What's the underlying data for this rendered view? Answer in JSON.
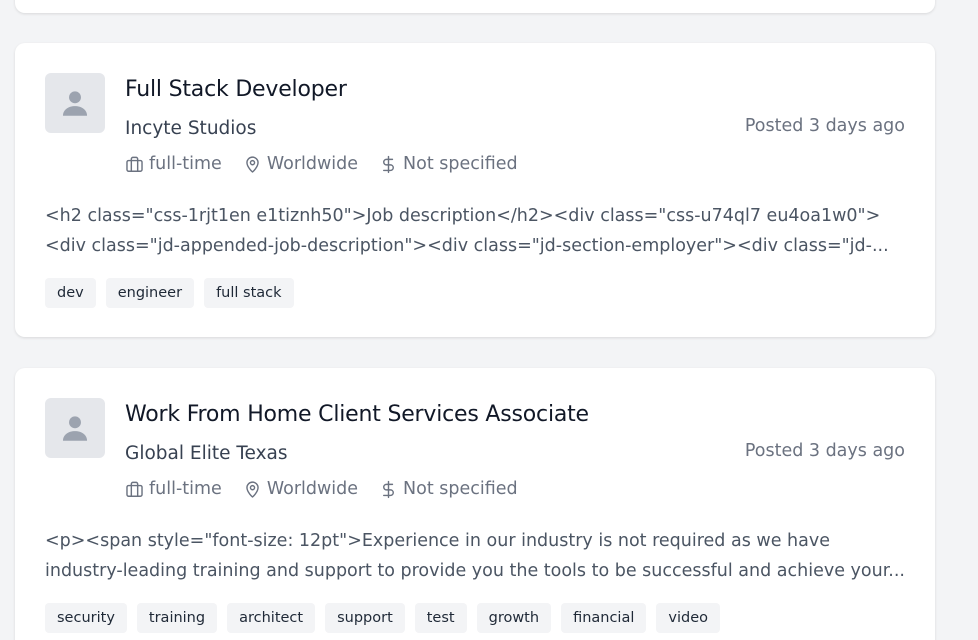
{
  "jobs": [
    {
      "title": "Full Stack Developer",
      "company": "Incyte Studios",
      "posted": "Posted 3 days ago",
      "type": "full-time",
      "location": "Worldwide",
      "salary": "Not specified",
      "description": "<h2 class=\"css-1rjt1en e1tiznh50\">Job description</h2><div class=\"css-u74ql7 eu4oa1w0\"><div class=\"jd-appended-job-description\"><div class=\"jd-section-employer\"><div class=\"jd-...",
      "tags": [
        "dev",
        "engineer",
        "full stack"
      ]
    },
    {
      "title": "Work From Home Client Services Associate",
      "company": "Global Elite Texas",
      "posted": "Posted 3 days ago",
      "type": "full-time",
      "location": "Worldwide",
      "salary": "Not specified",
      "description": "<p><span style=\"font-size: 12pt\">Experience in our industry is not required as we have industry-leading training and support to provide you the tools to be successful and achieve your...",
      "tags": [
        "security",
        "training",
        "architect",
        "support",
        "test",
        "growth",
        "financial",
        "video"
      ]
    }
  ],
  "icons": {
    "avatar": "person-placeholder-icon",
    "type": "briefcase-icon",
    "location": "map-pin-icon",
    "salary": "dollar-icon"
  },
  "colors": {
    "background": "#f3f4f6",
    "card": "#ffffff",
    "muted_text": "#6b7280",
    "tag_bg": "#f3f4f6",
    "avatar_bg": "#e5e7eb"
  }
}
